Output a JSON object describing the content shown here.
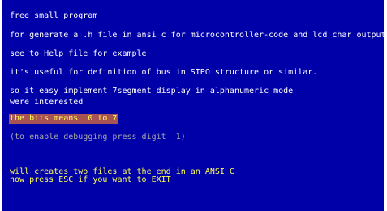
{
  "screen": {
    "lines": [
      "free small program",
      "for generate a .h file in ansi c for microcontroller-code and lcd char output",
      "see to Help file for example",
      "it's useful for definition of bus in SIPO structure or similar.",
      "so it easy implement 7segment display in alphanumeric mode",
      "were interested",
      "the bits means  0 to 7",
      "(to enable debugging press digit  1)",
      "will creates two files at the end in an ANSI C",
      "now press ESC if you want to EXIT"
    ]
  },
  "colors": {
    "background": "#0000a8",
    "text_white": "#ffffff",
    "text_gray": "#a8a8a8",
    "text_yellow": "#ffff54",
    "highlight_bg": "#a85454"
  }
}
